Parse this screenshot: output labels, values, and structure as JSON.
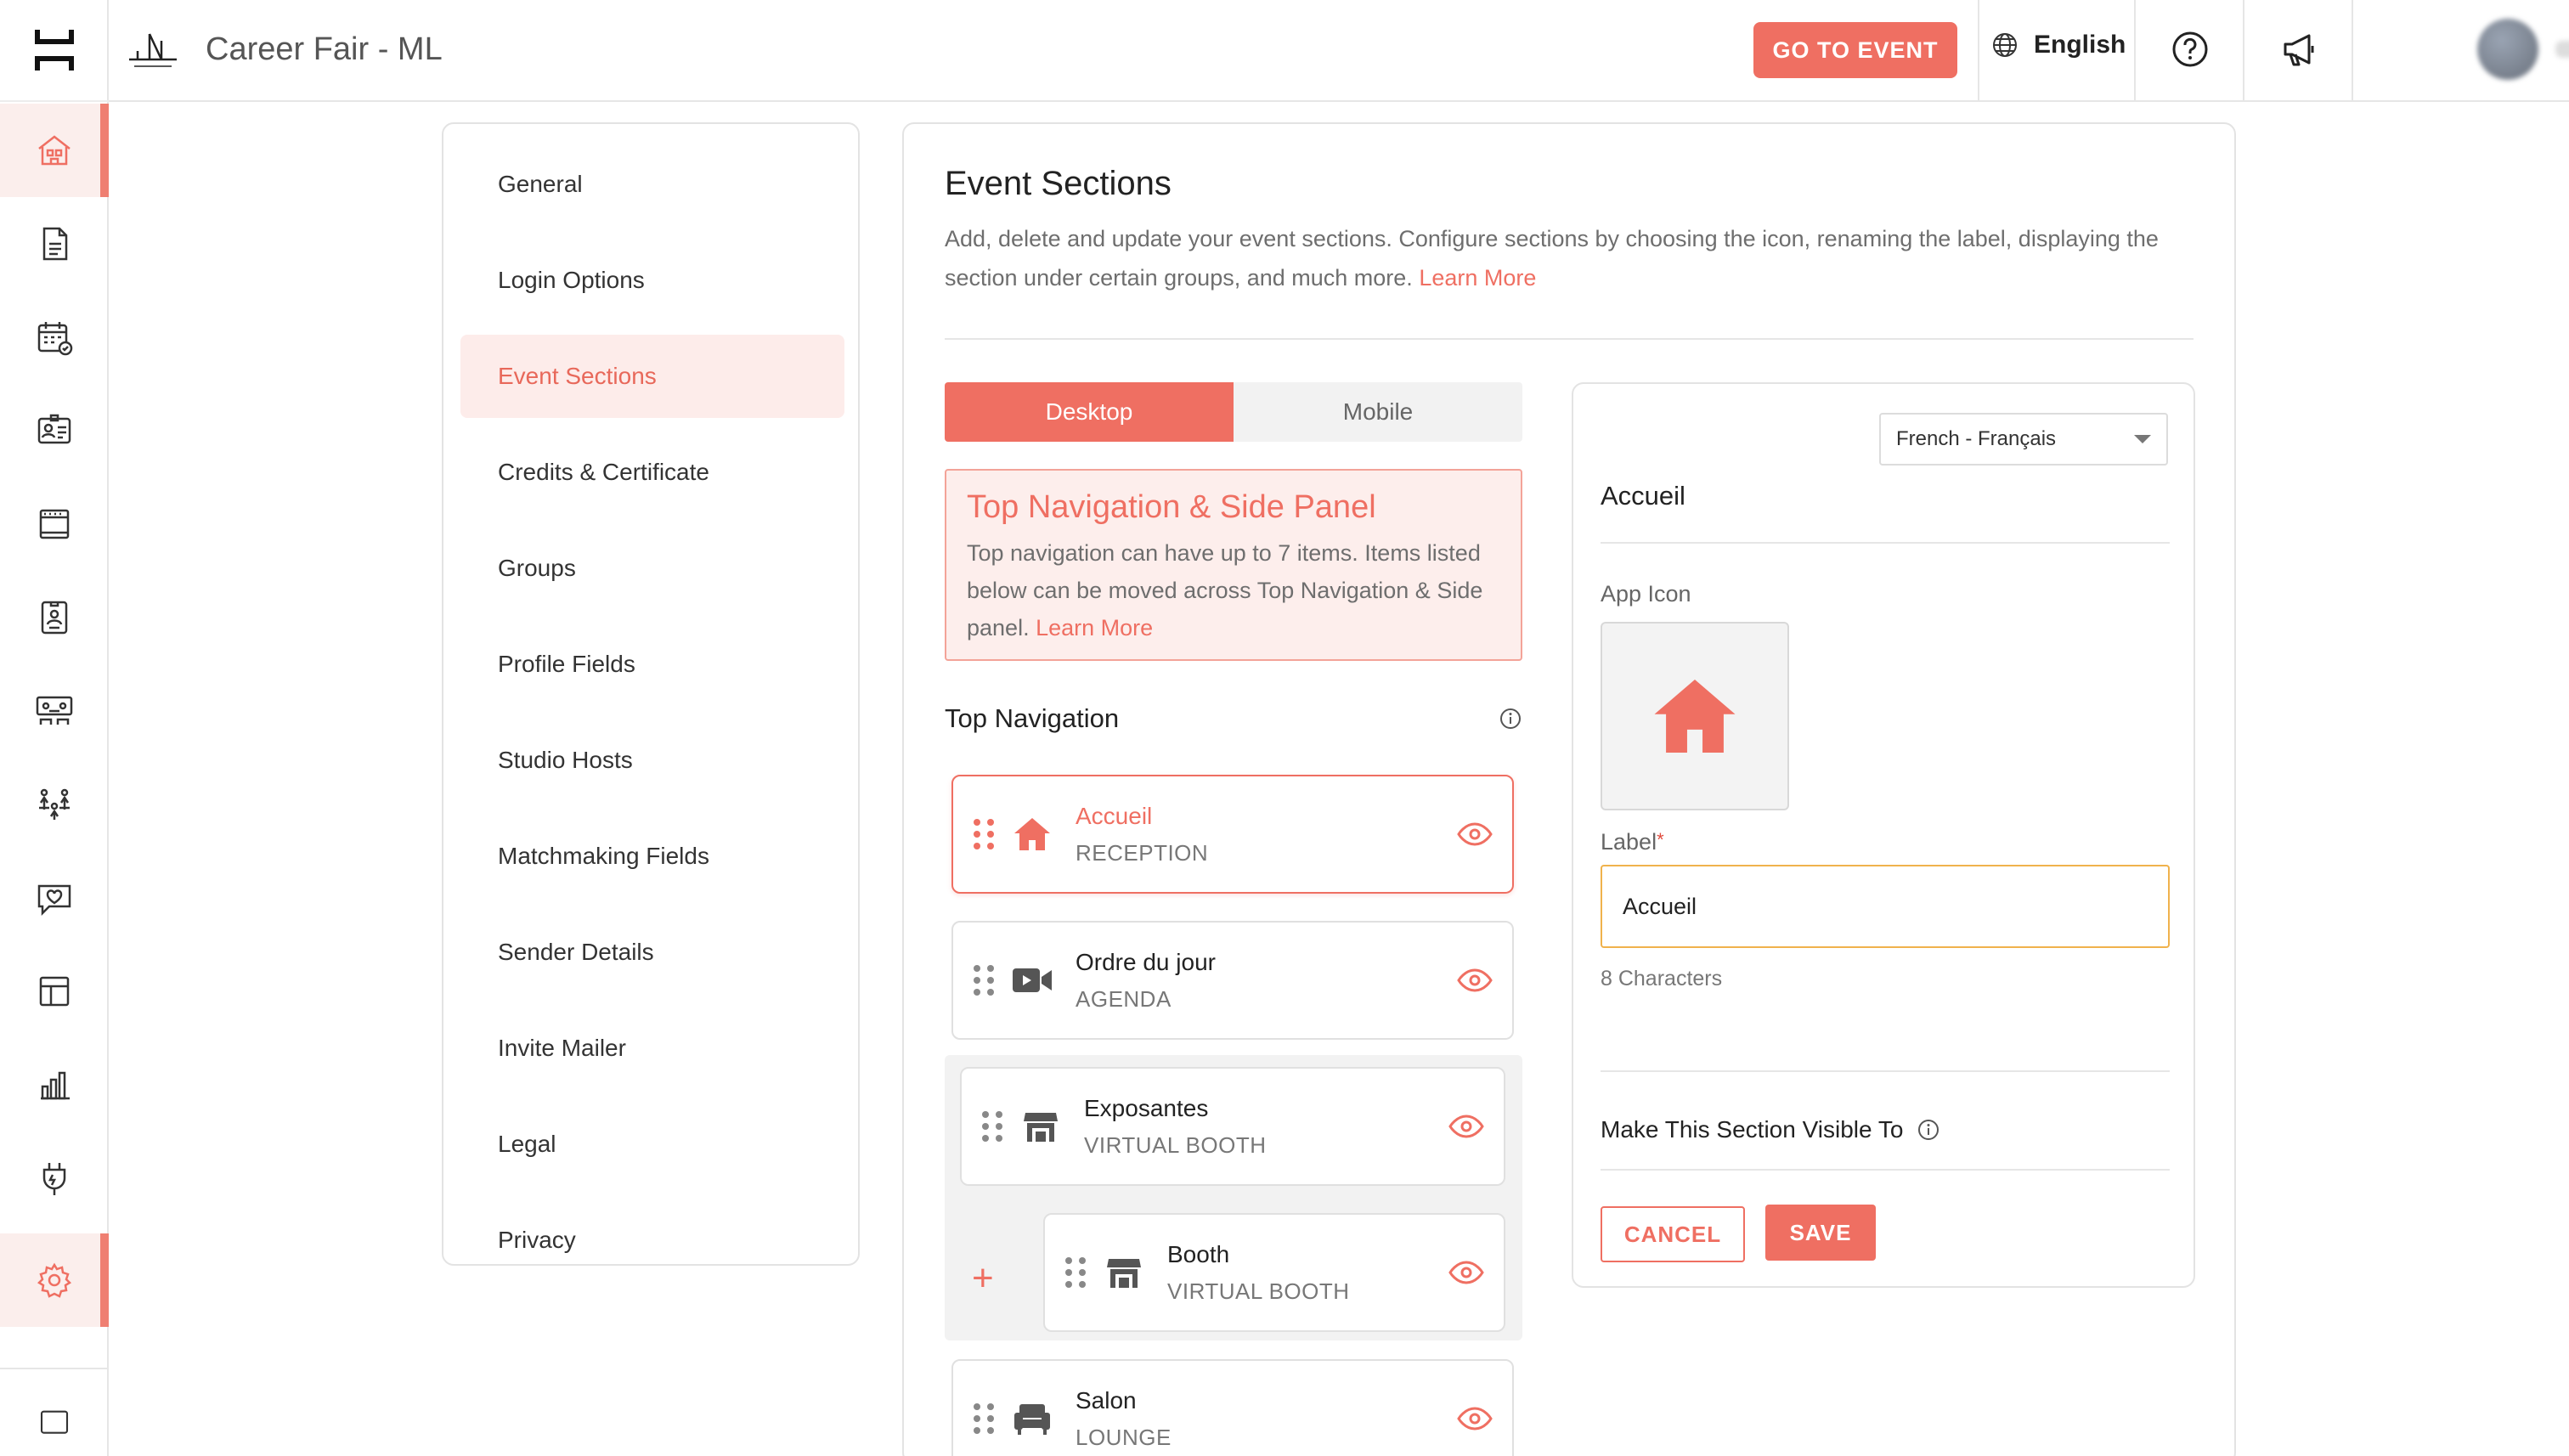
{
  "header": {
    "title": "Career Fair - ML",
    "go_to_event": "GO TO EVENT",
    "language": "English"
  },
  "sidebar": {
    "items": [
      {
        "icon": "event-home-icon",
        "active": true
      },
      {
        "icon": "document-icon"
      },
      {
        "icon": "calendar-icon"
      },
      {
        "icon": "id-card-icon"
      },
      {
        "icon": "booth-icon"
      },
      {
        "icon": "badge-icon"
      },
      {
        "icon": "lounge-icon"
      },
      {
        "icon": "people-icon"
      },
      {
        "icon": "chat-heart-icon"
      },
      {
        "icon": "layout-icon"
      },
      {
        "icon": "analytics-icon"
      },
      {
        "icon": "integrations-icon"
      },
      {
        "icon": "settings-icon",
        "active": true
      }
    ]
  },
  "settings_menu": {
    "items": [
      "General",
      "Login Options",
      "Event Sections",
      "Credits & Certificate",
      "Groups",
      "Profile Fields",
      "Studio Hosts",
      "Matchmaking Fields",
      "Sender Details",
      "Invite Mailer",
      "Legal",
      "Privacy"
    ],
    "active": "Event Sections"
  },
  "main": {
    "title": "Event Sections",
    "description": "Add, delete and update your event sections. Configure sections by choosing the icon, renaming the label, displaying the section under certain groups, and much more.",
    "learn_more": "Learn More",
    "tabs": [
      "Desktop",
      "Mobile"
    ],
    "active_tab": "Desktop",
    "notice": {
      "title": "Top Navigation & Side Panel",
      "text": "Top navigation can have up to 7 items. Items listed below can be moved across Top Navigation & Side panel.",
      "learn_more": "Learn More"
    },
    "top_navigation_label": "Top Navigation",
    "nav_items": [
      {
        "title": "Accueil",
        "subtitle": "RECEPTION",
        "icon": "home-icon",
        "active": true
      },
      {
        "title": "Ordre du jour",
        "subtitle": "AGENDA",
        "icon": "video-icon"
      },
      {
        "title": "Exposantes",
        "subtitle": "VIRTUAL BOOTH",
        "icon": "store-icon"
      },
      {
        "title": "Booth",
        "subtitle": "VIRTUAL BOOTH",
        "icon": "store-icon"
      },
      {
        "title": "Salon",
        "subtitle": "LOUNGE",
        "icon": "sofa-icon"
      }
    ]
  },
  "editor": {
    "language_select": "French - Français",
    "title": "Accueil",
    "app_icon_label": "App Icon",
    "label_label": "Label",
    "label_required": "*",
    "label_value": "Accueil",
    "char_count": "8 Characters",
    "visibility_label": "Make This Section Visible To",
    "cancel": "CANCEL",
    "save": "SAVE"
  },
  "colors": {
    "accent": "#ef6f62",
    "accent_light": "#fdeeec",
    "input_focus": "#f0b24c"
  }
}
